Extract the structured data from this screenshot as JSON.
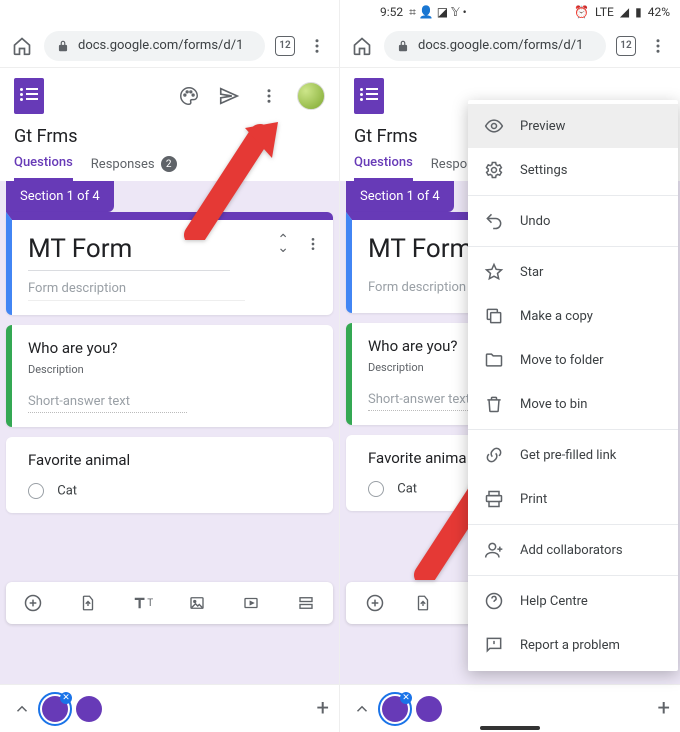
{
  "status": {
    "time": "9:52",
    "net": "LTE",
    "battery": "42%"
  },
  "browser": {
    "url": "docs.google.com/forms/d/1",
    "tabs": "12"
  },
  "form": {
    "doc_title": "Gt Frms",
    "tabs": {
      "questions": "Questions",
      "responses": "Responses",
      "response_count": "2"
    },
    "section_label": "Section 1 of 4",
    "title": "MT Form",
    "description_placeholder": "Form description",
    "q1": {
      "title": "Who are you?",
      "desc": "Description",
      "ans": "Short-answer text"
    },
    "q2": {
      "title": "Favorite animal",
      "opt1": "Cat"
    }
  },
  "menu": {
    "preview": "Preview",
    "settings": "Settings",
    "undo": "Undo",
    "star": "Star",
    "copy": "Make a copy",
    "move_folder": "Move to folder",
    "move_bin": "Move to bin",
    "prefilled": "Get pre-filled link",
    "print": "Print",
    "collab": "Add collaborators",
    "help": "Help Centre",
    "report": "Report a problem"
  }
}
